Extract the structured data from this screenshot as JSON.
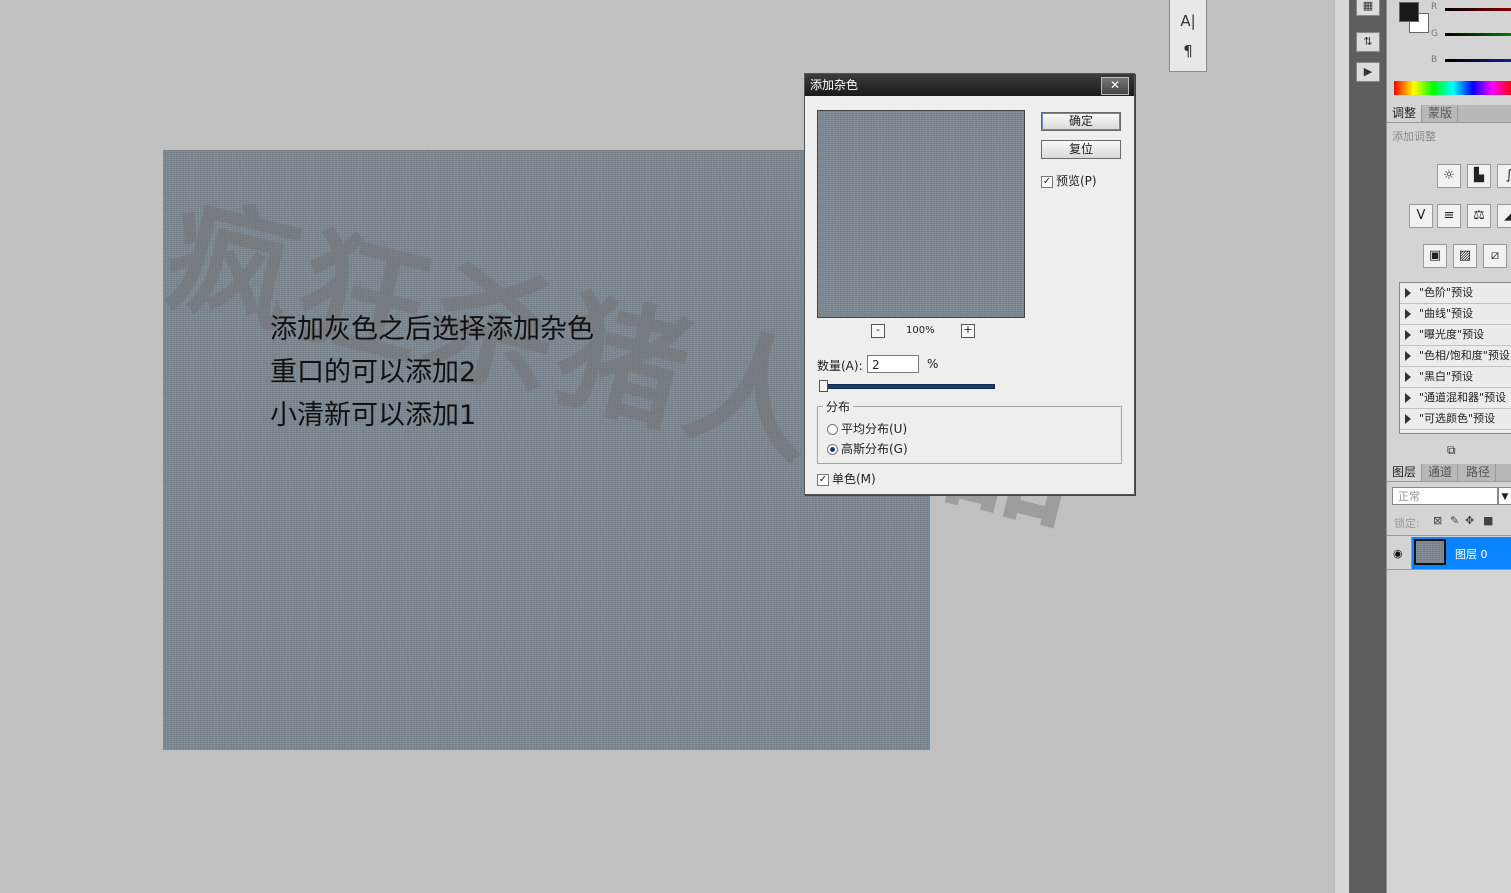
{
  "canvas": {
    "note_lines": [
      "添加灰色之后选择添加杂色",
      "重口的可以添加2",
      "小清新可以添加1"
    ],
    "watermark": "疯狂杀猪人出品"
  },
  "char_palette": {
    "icon1": "A|",
    "icon2": "¶"
  },
  "dialog": {
    "title": "添加杂色",
    "close": "✕",
    "ok_label": "确定",
    "reset_label": "复位",
    "preview_label": "预览(P)",
    "preview_checked": true,
    "zoom_out": "-",
    "zoom_in": "+",
    "zoom_level": "100%",
    "amount_label": "数量(A):",
    "amount_value": "2",
    "amount_unit": "%",
    "amount_fraction": 0.02,
    "distribution_label": "分布",
    "uniform_label": "平均分布(U)",
    "gaussian_label": "高斯分布(G)",
    "selected_distribution": "gaussian",
    "mono_label": "单色(M)",
    "mono_checked": true
  },
  "color_panel": {
    "channels": [
      "R",
      "G",
      "B"
    ],
    "channel_colors": [
      "#8b0000",
      "#006400",
      "#00008b"
    ],
    "foreground": "#1a1a1a",
    "background": "#ffffff"
  },
  "adjustments_panel": {
    "tabs": [
      "调整",
      "蒙版"
    ],
    "subtitle": "添加调整",
    "icons": [
      "brightness-icon",
      "levels-icon",
      "curves-icon",
      "vibrance-icon",
      "hue-icon",
      "balance-icon",
      "exposure-icon",
      "photo-filter-icon",
      "channel-mixer-icon",
      "invert-icon"
    ],
    "presets": [
      "\"色阶\"预设",
      "\"曲线\"预设",
      "\"曝光度\"预设",
      "\"色相/饱和度\"预设",
      "\"黑白\"预设",
      "\"通道混和器\"预设",
      "\"可选颜色\"预设"
    ]
  },
  "layers_panel": {
    "tabs": [
      "图层",
      "通道",
      "路径"
    ],
    "blend_mode": "正常",
    "lock_label": "锁定:",
    "layer_name": "图层 0"
  }
}
